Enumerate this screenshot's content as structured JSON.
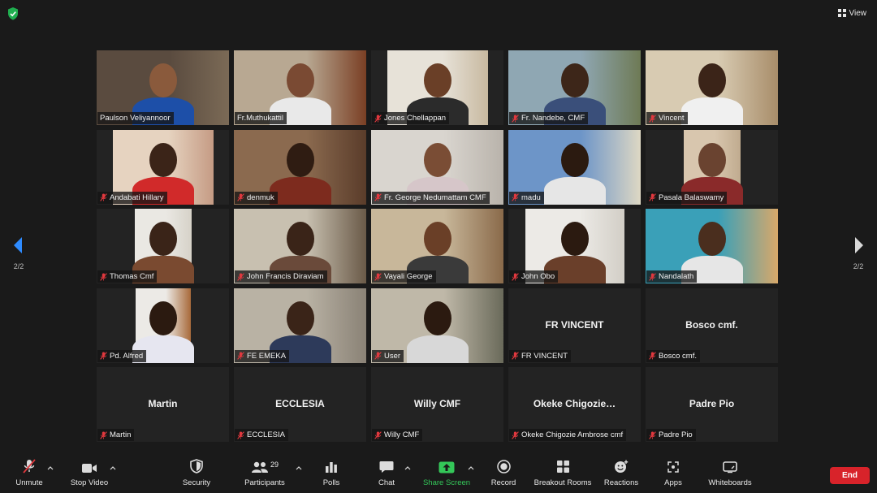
{
  "topbar": {
    "view_label": "View"
  },
  "pagination": {
    "left": "2/2",
    "right": "2/2"
  },
  "tiles": [
    {
      "name": "Paulson Veliyannoor",
      "video": true,
      "active": true,
      "muted": false,
      "wall": "#5a4b3f",
      "bg2": "#7b6a56",
      "skin": "#8a5a3c",
      "shirt": "#1d4fa8"
    },
    {
      "name": "Fr.Muthukattil",
      "video": true,
      "muted": false,
      "wall": "#b8a892",
      "bg2": "#7a3f24",
      "skin": "#7a4a33",
      "shirt": "#e9e9e9"
    },
    {
      "name": "Jones Chellappan",
      "video": true,
      "muted": true,
      "wall": "#e7e2d8",
      "bg2": "#c8b9a0",
      "skin": "#6a3f27",
      "shirt": "#2b2b2b"
    },
    {
      "name": "Fr. Nandebe, CMF",
      "video": true,
      "muted": true,
      "wall": "#8fa7b3",
      "bg2": "#6e7a55",
      "skin": "#3d2619",
      "shirt": "#3a4f7a"
    },
    {
      "name": "Vincent",
      "video": true,
      "muted": true,
      "wall": "#d8cbb2",
      "bg2": "#a88d6a",
      "skin": "#3b2418",
      "shirt": "#f0f0f0"
    },
    {
      "name": "Andabati Hillary",
      "video": true,
      "muted": true,
      "wall": "#e6d3c0",
      "bg2": "#c59b84",
      "skin": "#3b2418",
      "shirt": "#d12a2a"
    },
    {
      "name": "denmuk",
      "video": true,
      "muted": true,
      "wall": "#8b6a4f",
      "bg2": "#5a3c2a",
      "skin": "#2f1c12",
      "shirt": "#7d2b1e"
    },
    {
      "name": "Fr. George Nedumattam CMF",
      "video": true,
      "muted": true,
      "wall": "#d9d5cf",
      "bg2": "#b9b3ab",
      "skin": "#7a4d35",
      "shirt": "#d6c6c9"
    },
    {
      "name": "madu",
      "video": true,
      "muted": true,
      "wall": "#6d95c8",
      "bg2": "#ded8c4",
      "skin": "#2b1a10",
      "shirt": "#e6e6e6"
    },
    {
      "name": "Pasala Balaswamy",
      "video": true,
      "muted": true,
      "wall": "#d8c6ae",
      "bg2": "#c0ab8f",
      "skin": "#6a4330",
      "shirt": "#8a2a2a"
    },
    {
      "name": "Thomas Cmf",
      "video": true,
      "muted": true,
      "wall": "#eae8e3",
      "bg2": "#d6d2c8",
      "skin": "#3a2418",
      "shirt": "#7a4a30"
    },
    {
      "name": "John Francis Diraviam",
      "video": true,
      "muted": true,
      "wall": "#c8c0b0",
      "bg2": "#6a5a48",
      "skin": "#3a2418",
      "shirt": "#6a4a3a"
    },
    {
      "name": "Vayali George",
      "video": true,
      "muted": true,
      "wall": "#c8b79a",
      "bg2": "#8a6a4a",
      "skin": "#6a3f27",
      "shirt": "#3a3a3a"
    },
    {
      "name": "John Obo",
      "video": true,
      "muted": true,
      "wall": "#eceae6",
      "bg2": "#d2cec6",
      "skin": "#2b1a10",
      "shirt": "#6a3f2a"
    },
    {
      "name": "Nandalath",
      "video": true,
      "muted": true,
      "wall": "#3aa0b8",
      "bg2": "#d8a86a",
      "skin": "#4a2e1e",
      "shirt": "#e6e6e6"
    },
    {
      "name": "Pd. Alfred",
      "video": true,
      "muted": true,
      "wall": "#eceae6",
      "bg2": "#a86a3a",
      "skin": "#2b1a10",
      "shirt": "#e6e6f0"
    },
    {
      "name": "FE EMEKA",
      "video": true,
      "muted": true,
      "wall": "#b9b2a4",
      "bg2": "#8a8276",
      "skin": "#3a2418",
      "shirt": "#2d3a5a"
    },
    {
      "name": "User",
      "video": true,
      "muted": true,
      "wall": "#bfb8a8",
      "bg2": "#6a6a5a",
      "skin": "#2b1a10",
      "shirt": "#d8d8d8"
    },
    {
      "name": "FR VINCENT",
      "video": false,
      "muted": true,
      "display": "FR VINCENT"
    },
    {
      "name": "Bosco cmf.",
      "video": false,
      "muted": true,
      "display": "Bosco cmf."
    },
    {
      "name": "Martin",
      "video": false,
      "muted": true,
      "display": "Martin"
    },
    {
      "name": "ECCLESIA",
      "video": false,
      "muted": true,
      "display": "ECCLESIA"
    },
    {
      "name": "Willy CMF",
      "video": false,
      "muted": true,
      "display": "Willy CMF"
    },
    {
      "name": "Okeke Chigozie Ambrose cmf",
      "video": false,
      "muted": true,
      "display": "Okeke  Chigozie…"
    },
    {
      "name": "Padre Pio",
      "video": false,
      "muted": true,
      "display": "Padre Pio"
    }
  ],
  "toolbar": {
    "unmute": "Unmute",
    "stop_video": "Stop Video",
    "security": "Security",
    "participants": "Participants",
    "participants_count": "29",
    "polls": "Polls",
    "chat": "Chat",
    "share_screen": "Share Screen",
    "record": "Record",
    "breakout_rooms": "Breakout Rooms",
    "reactions": "Reactions",
    "apps": "Apps",
    "whiteboards": "Whiteboards",
    "end": "End"
  },
  "colors": {
    "share_green": "#34c759",
    "end_red": "#d8232a",
    "active_speaker": "#d7e04a",
    "mute_red": "#e0383e"
  }
}
